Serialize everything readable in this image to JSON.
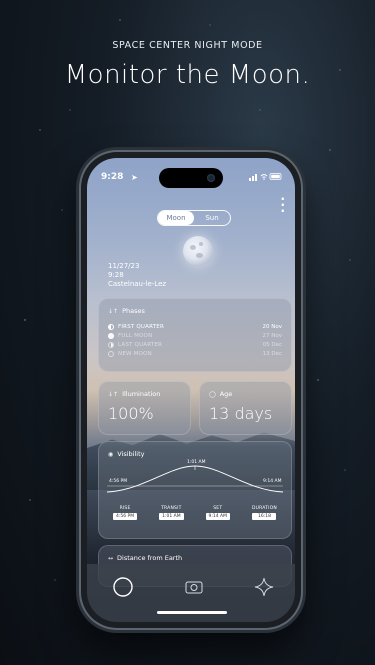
{
  "hero": {
    "kicker": "SPACE CENTER NIGHT MODE",
    "title": "Monitor the Moon."
  },
  "status_bar": {
    "time": "9:28",
    "location_arrow": "➤"
  },
  "toggle": {
    "moon_label": "Moon",
    "sun_label": "Sun",
    "selected": "Moon"
  },
  "info": {
    "date": "11/27/23",
    "time": "9:28",
    "location": "Castelnau-le-Lez"
  },
  "phases": {
    "title": "Phases",
    "items": [
      {
        "name": "FIRST QUARTER",
        "date": "20 Nov"
      },
      {
        "name": "FULL MOON",
        "date": "27 Nov"
      },
      {
        "name": "LAST QUARTER",
        "date": "05 Dec"
      },
      {
        "name": "NEW MOON",
        "date": "13 Dec"
      }
    ]
  },
  "illumination": {
    "title": "Illumination",
    "value": "100%"
  },
  "age": {
    "title": "Age",
    "value": "13 days"
  },
  "visibility": {
    "title": "Visibility",
    "peak_label": "1:01 AM",
    "rise_label": "4:56 PM",
    "set_label": "9:14 AM",
    "stats": [
      {
        "label": "RISE",
        "value": "4:56 PM"
      },
      {
        "label": "TRANSIT",
        "value": "1:01 AM"
      },
      {
        "label": "SET",
        "value": "9:14 AM"
      },
      {
        "label": "DURATION",
        "value": "16:18"
      }
    ]
  },
  "distance": {
    "title": "Distance from Earth"
  },
  "tabs": [
    {
      "icon": "moon-circle-icon",
      "label": "Moon"
    },
    {
      "icon": "camera-icon",
      "label": "Camera"
    },
    {
      "icon": "sparkle-icon",
      "label": "Explore"
    }
  ],
  "colors": {
    "sky_top": "#8ea3c8",
    "horizon": "#cfc1b2",
    "background": "#141c25"
  }
}
